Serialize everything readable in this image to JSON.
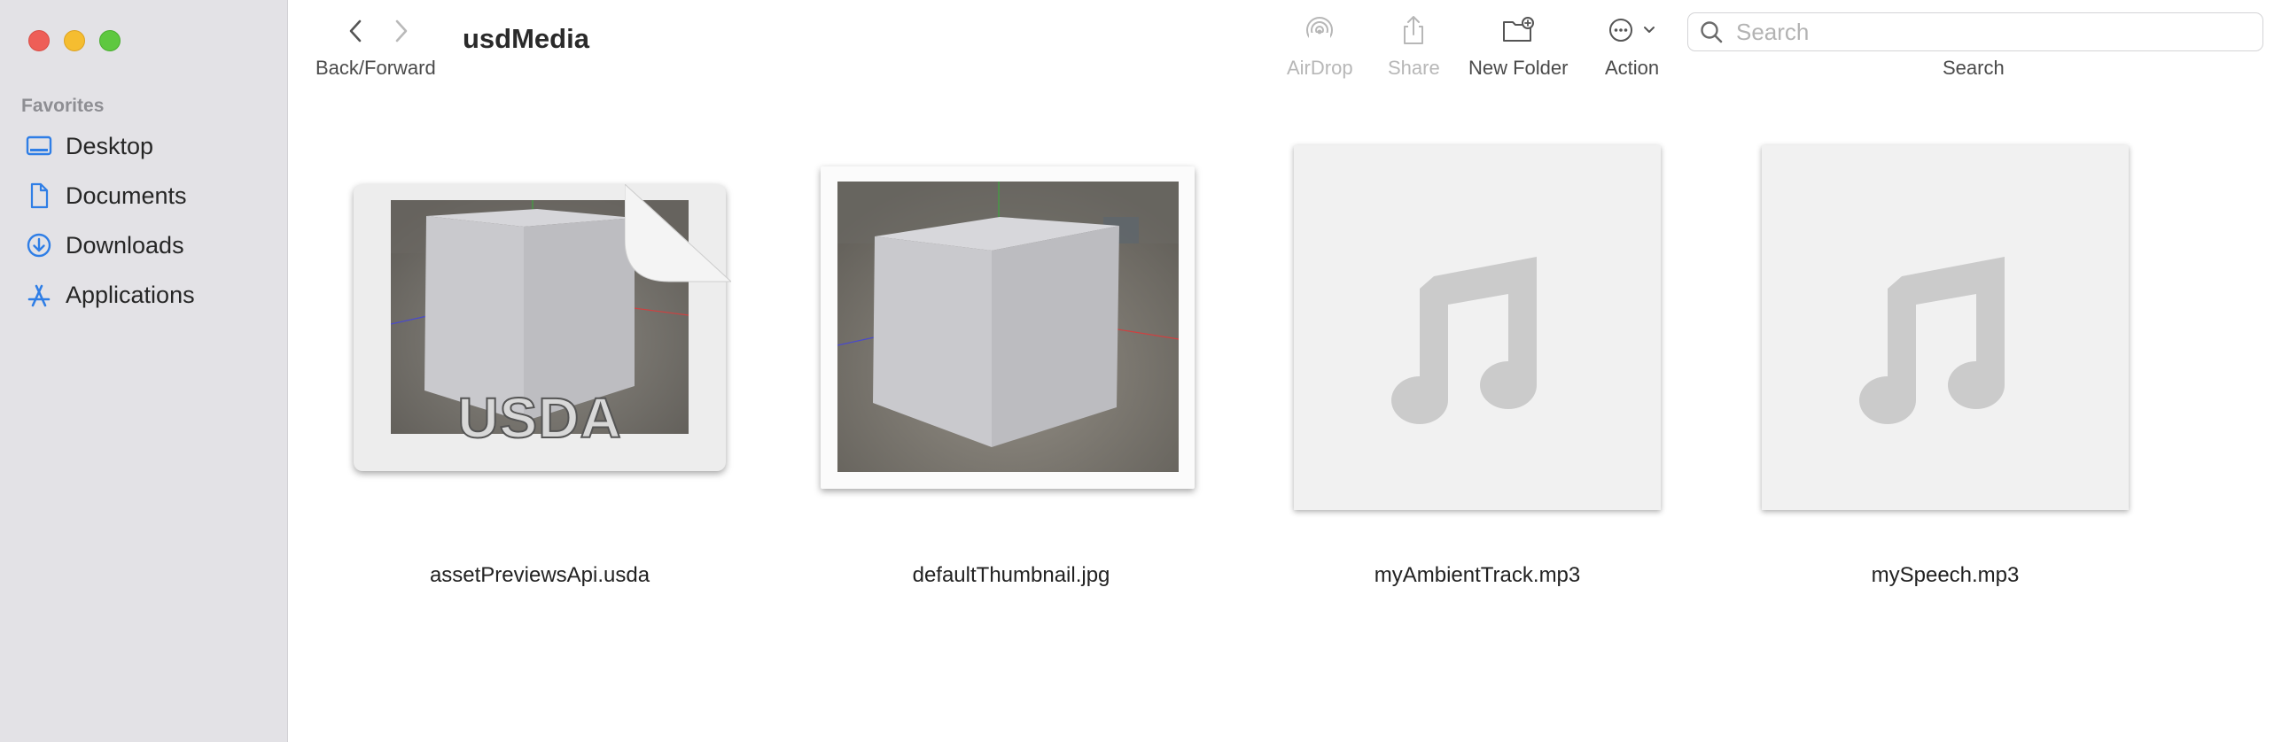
{
  "window": {
    "title": "usdMedia"
  },
  "sidebar": {
    "favorites_header": "Favorites",
    "items": [
      {
        "label": "Desktop",
        "icon": "desktop-icon"
      },
      {
        "label": "Documents",
        "icon": "document-icon"
      },
      {
        "label": "Downloads",
        "icon": "download-icon"
      },
      {
        "label": "Applications",
        "icon": "applications-icon"
      }
    ]
  },
  "toolbar": {
    "back_forward_label": "Back/Forward",
    "airdrop_label": "AirDrop",
    "share_label": "Share",
    "new_folder_label": "New Folder",
    "action_label": "Action",
    "search_label": "Search",
    "search_placeholder": "Search",
    "search_value": ""
  },
  "files": [
    {
      "name": "assetPreviewsApi.usda",
      "kind": "usda",
      "badge": "USDA"
    },
    {
      "name": "defaultThumbnail.jpg",
      "kind": "image"
    },
    {
      "name": "myAmbientTrack.mp3",
      "kind": "audio"
    },
    {
      "name": "mySpeech.mp3",
      "kind": "audio"
    }
  ],
  "colors": {
    "sidebar_bg": "#e3e2e6",
    "accent_icon": "#2f7ee6",
    "close": "#ee5e57",
    "minimize": "#f5bd30",
    "maximize": "#5ec840"
  }
}
